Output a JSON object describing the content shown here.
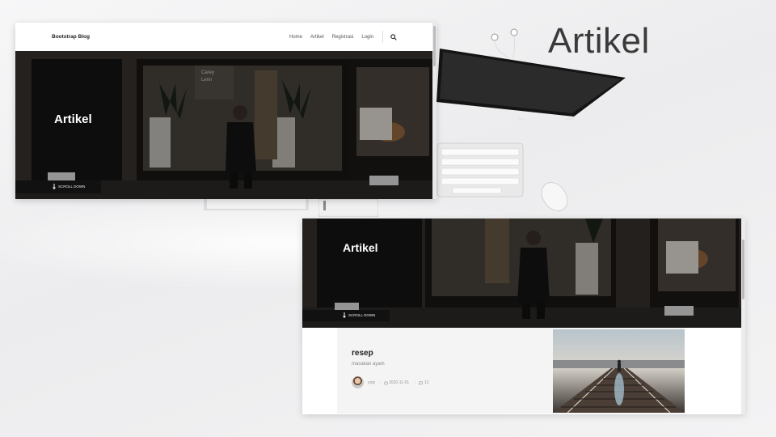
{
  "slide": {
    "title": "Artikel"
  },
  "site": {
    "brand": "Bootstrap Blog",
    "nav": [
      {
        "label": "Home"
      },
      {
        "label": "Artikel"
      },
      {
        "label": "Registrasi"
      },
      {
        "label": "Login"
      }
    ],
    "search_icon": "search-icon",
    "hero_title": "Artikel",
    "scroll_label": "SCROLL DOWN",
    "scroll_icon": "arrow-down-icon",
    "sign_text": "Carey Lenn"
  },
  "post": {
    "title": "resep",
    "subtitle": "masakan ayam",
    "author": "yopi",
    "date": "2020-11-01",
    "comments": "12",
    "clock_icon": "clock-icon",
    "comment_icon": "comment-icon"
  },
  "colors": {
    "dark": "#111111",
    "text": "#222222",
    "muted": "#999999",
    "slide_title": "#3a3a3a"
  }
}
